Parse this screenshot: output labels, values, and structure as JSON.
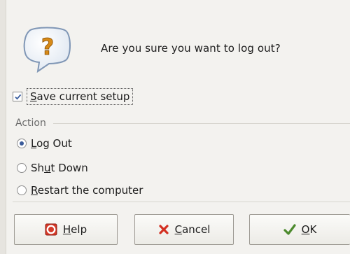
{
  "dialog": {
    "message": "Are you sure you want to log out?"
  },
  "save_setup": {
    "checked": true,
    "label_mnemonic": "S",
    "label_rest": "ave current setup"
  },
  "action_group": {
    "title": "Action",
    "options": [
      {
        "pre": "",
        "mnemonic": "L",
        "post": "og Out",
        "selected": true
      },
      {
        "pre": "Sh",
        "mnemonic": "u",
        "post": "t Down",
        "selected": false
      },
      {
        "pre": "",
        "mnemonic": "R",
        "post": "estart the computer",
        "selected": false
      }
    ]
  },
  "buttons": {
    "help": {
      "mnemonic": "H",
      "rest": "elp"
    },
    "cancel": {
      "mnemonic": "C",
      "rest": "ancel"
    },
    "ok": {
      "mnemonic": "O",
      "rest": "K"
    }
  },
  "colors": {
    "help_icon": "#d63a2a",
    "cancel_icon": "#d32f21",
    "ok_icon": "#4c8a2d",
    "radio_selected": "#3a5b9a"
  }
}
